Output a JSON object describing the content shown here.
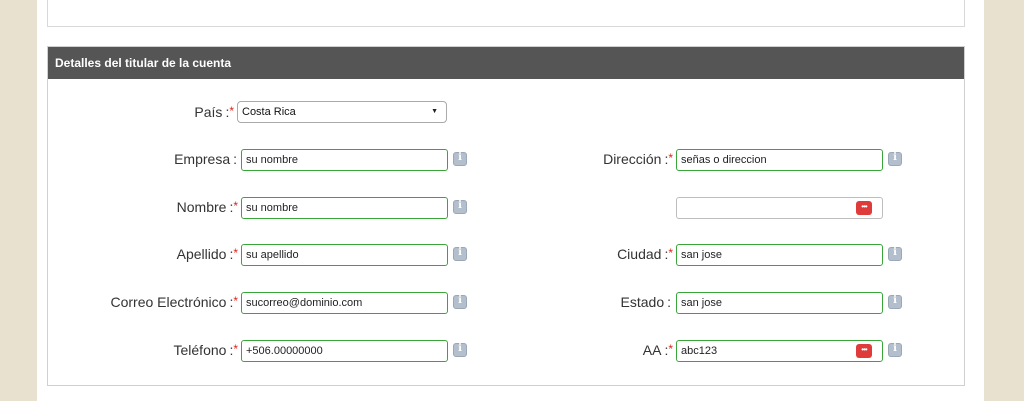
{
  "section": {
    "title": "Detalles del titular de la cuenta"
  },
  "form": {
    "country": {
      "label": "País",
      "value": "Costa Rica",
      "required": true
    },
    "company": {
      "label": "Empresa",
      "value": "su nombre",
      "required": false
    },
    "first_name": {
      "label": "Nombre",
      "value": "su nombre",
      "required": true
    },
    "last_name": {
      "label": "Apellido",
      "value": "su apellido",
      "required": true
    },
    "email": {
      "label": "Correo Electrónico",
      "value": "sucorreo@dominio.com",
      "required": true
    },
    "phone": {
      "label": "Teléfono",
      "value": "+506.00000000",
      "required": true
    },
    "address": {
      "label": "Dirección",
      "value": "señas o direccion",
      "required": true
    },
    "address2": {
      "label": "",
      "value": ""
    },
    "city": {
      "label": "Ciudad",
      "value": "san jose",
      "required": true
    },
    "state": {
      "label": "Estado",
      "value": "san jose",
      "required": false
    },
    "aa": {
      "label": "AA",
      "value": "abc123",
      "required": true
    }
  },
  "marks": {
    "required": "*",
    "colon": ":"
  },
  "colors": {
    "header_bg": "#555555",
    "valid_border": "#3aa63a",
    "required": "#d9261c",
    "page_bg": "#e8e1cf"
  }
}
